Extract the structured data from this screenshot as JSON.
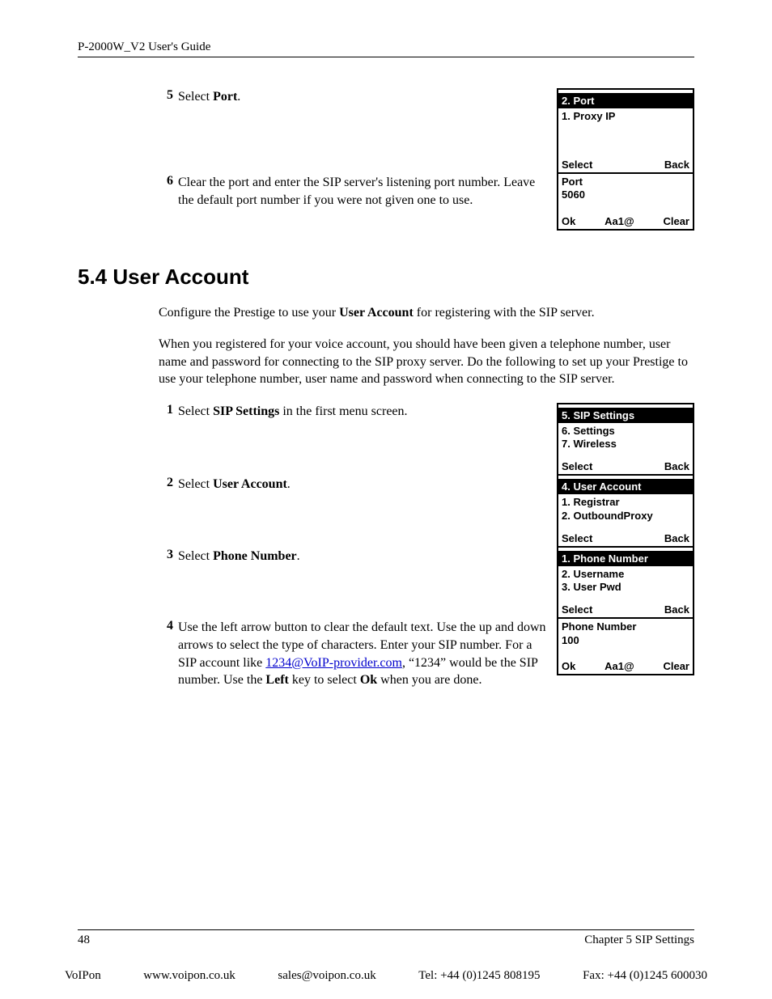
{
  "header": {
    "title": "P-2000W_V2 User's Guide"
  },
  "steps_top": {
    "s5": {
      "num": "5",
      "pre": "Select ",
      "bold": "Port",
      "post": "."
    },
    "s6": {
      "num": "6",
      "text": "Clear the port and enter the SIP server's listening port number. Leave the default port number if you were not given one to use."
    }
  },
  "device_port_menu": {
    "title": "2. Port",
    "row1": "1. Proxy IP",
    "left": "Select",
    "right": "Back"
  },
  "device_port_entry": {
    "row1": "Port",
    "row2": "5060",
    "left": "Ok",
    "mid": "Aa1@",
    "right": "Clear"
  },
  "section": {
    "heading": "5.4  User Account",
    "p1_pre": "Configure the Prestige to use your ",
    "p1_bold": "User Account",
    "p1_post": " for registering with the SIP server.",
    "p2": "When you registered for your voice account, you should have been given a telephone number, user name and password for connecting to the SIP proxy server. Do the following to set up your Prestige to use your telephone number, user name and password when connecting to the SIP server."
  },
  "steps_ua": {
    "s1": {
      "num": "1",
      "pre": "Select ",
      "bold": "SIP Settings",
      "post": " in the first menu screen."
    },
    "s2": {
      "num": "2",
      "pre": "Select ",
      "bold": "User Account",
      "post": "."
    },
    "s3": {
      "num": "3",
      "pre": "Select ",
      "bold": "Phone Number",
      "post": "."
    },
    "s4": {
      "num": "4",
      "seg1": "Use the left arrow button to clear the default text. Use the up and down arrows to select the type of characters. Enter your SIP number. For a SIP account like ",
      "link": "1234@VoIP-provider.com",
      "seg2": ", “1234” would be the SIP number. Use the ",
      "bold1": "Left",
      "seg3": " key to select ",
      "bold2": "Ok",
      "seg4": " when you are done."
    }
  },
  "device_sip_settings": {
    "title": "5. SIP Settings",
    "row1": "6. Settings",
    "row2": "7. Wireless",
    "left": "Select",
    "right": "Back"
  },
  "device_user_account": {
    "title": "4. User Account",
    "row1": "1. Registrar",
    "row2": "2. OutboundProxy",
    "left": "Select",
    "right": "Back"
  },
  "device_phone_number_menu": {
    "title": "1. Phone Number",
    "row1": "2. Username",
    "row2": "3. User Pwd",
    "left": "Select",
    "right": "Back"
  },
  "device_phone_number_entry": {
    "row1": "Phone Number",
    "row2": "100",
    "left": "Ok",
    "mid": "Aa1@",
    "right": "Clear"
  },
  "footer": {
    "page_num": "48",
    "chapter": "Chapter 5 SIP Settings"
  },
  "vendor": {
    "name": "VoIPon",
    "web": "www.voipon.co.uk",
    "email": "sales@voipon.co.uk",
    "tel": "Tel: +44 (0)1245 808195",
    "fax": "Fax: +44 (0)1245 600030"
  }
}
